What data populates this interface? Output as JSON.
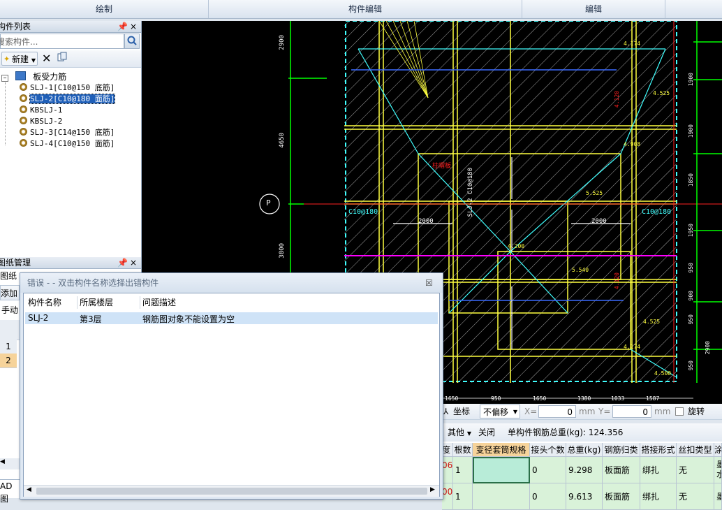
{
  "ribbon": {
    "tabs": [
      "绘制",
      "构件编辑",
      "编辑"
    ]
  },
  "component_list": {
    "title": "构件列表",
    "pin": "ᵖ",
    "close": "×",
    "search_placeholder": "搜索构件...",
    "new_label": "新建",
    "tree_root": "板受力筋",
    "items": [
      "SLJ-1[C10@150 底筋]",
      "SLJ-2[C10@180 面筋]",
      "KBSLJ-1",
      "KBSLJ-2",
      "SLJ-3[C14@150 底筋]",
      "SLJ-4[C10@150 面筋]"
    ],
    "selected_index": 1
  },
  "drawing_mgmt": {
    "title": "图纸管理",
    "row1": "图纸",
    "add": "添加",
    "manual": "手动",
    "rows": [
      "1",
      "2"
    ],
    "bottom": "AD图"
  },
  "canvas": {
    "labels": [
      "2900",
      "4650",
      "3800",
      "P",
      "C10@180",
      "C10@180",
      "2000",
      "2000",
      "SLJ-2 C10@180",
      "4.174",
      "4.525",
      "4.908",
      "5.525",
      "5.540",
      "4.525",
      "4.174",
      "4.500",
      "4.200",
      "柱帽板",
      "4.120",
      "4.120",
      "1900",
      "1900",
      "1850",
      "1950",
      "950",
      "900",
      "950",
      "950",
      "2900"
    ],
    "bottom_dims": [
      "1650",
      "950",
      "1650",
      "1380",
      "1033",
      "1587"
    ]
  },
  "dialog": {
    "title": "错误 - - 双击构件名称选择出错构件",
    "close": "☒",
    "columns": [
      "构件名称",
      "所属楼层",
      "问题描述"
    ],
    "rows": [
      {
        "name": "SLJ-2",
        "floor": "第3层",
        "desc": "钢筋图对象不能设置为空"
      }
    ]
  },
  "coord_bar": {
    "coord_label": "坐标",
    "offset_select": "不偏移",
    "x_label": "X=",
    "x_value": "0",
    "y_label": "Y=",
    "y_value": "0",
    "unit": "mm",
    "rotate_label": "旋转"
  },
  "rebar_bar": {
    "other_label": "其他",
    "close_label": "关闭",
    "weight_label": "单构件钢筋总重(kg): 124.356"
  },
  "grid": {
    "columns": [
      "度",
      "根数",
      "变径套筒规格",
      "接头个数",
      "总重(kg)",
      "钢筋归类",
      "搭接形式",
      "丝扣类型",
      "涂"
    ],
    "rows": [
      {
        "c0": "06",
        "c1": "1",
        "c2": "",
        "c3": "0",
        "c4": "9.298",
        "c5": "板面筋",
        "c6": "绑扎",
        "c7": "无",
        "c8": "墨水"
      },
      {
        "c0": "00",
        "c1": "1",
        "c2": "",
        "c3": "0",
        "c4": "9.613",
        "c5": "板面筋",
        "c6": "绑扎",
        "c7": "无",
        "c8": "墨"
      }
    ]
  },
  "colors": {
    "canvas": "#000000",
    "yellow": "#ffff40",
    "cyan": "#40ffff",
    "red": "#ff2020",
    "magenta": "#ff00ff",
    "green": "#00ff00",
    "accent_header": "#f6d39a"
  }
}
